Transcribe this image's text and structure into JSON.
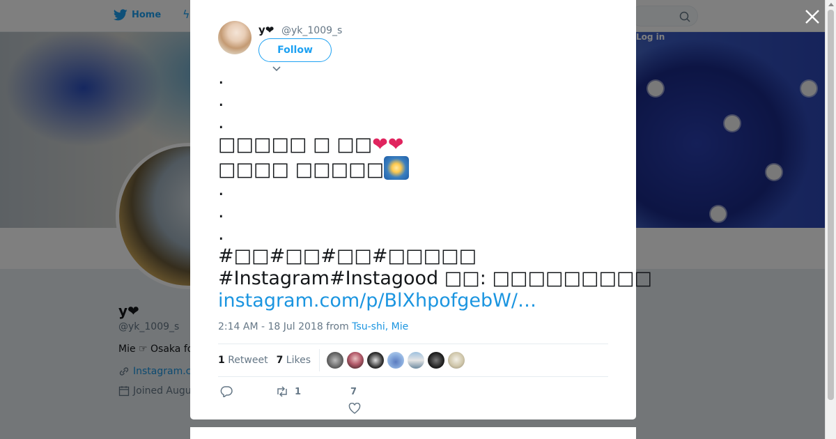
{
  "background": {
    "nav": {
      "home_label": "Home",
      "login_label": "Log in"
    },
    "profile": {
      "name": "y❤",
      "handle": "@yk_1009_s",
      "bio": "Mie ☞ Osaka fo",
      "link": "Instagram.c",
      "joined": "Joined Augu"
    }
  },
  "tweet": {
    "display_name": "y❤",
    "screen_name": "@yk_1009_s",
    "follow_label": "Follow",
    "text_lines": [
      ".",
      ".",
      ".",
      "□□□□□ □ □□",
      "□□□□ □□□□□",
      ".",
      ".",
      ".",
      "#□□#□□#□□#□□□□□",
      "#Instagram#Instagood □□: □□□□□□□□□"
    ],
    "link_text": "instagram.com/p/BlXhpofgebW/…",
    "timestamp": "2:14 AM - 18 Jul 2018 from ",
    "location": "Tsu-shi, Mie",
    "retweet_count": "1",
    "retweet_label": "Retweet",
    "likes_count": "7",
    "likes_label": "Likes",
    "action_retweet_count": "1",
    "action_like_count": "7"
  },
  "colors": {
    "accent": "#1da1f2",
    "link": "#1b95e0",
    "heart": "#e0245e",
    "text": "#14171a",
    "muted": "#657786"
  },
  "icons": [
    "twitter-bird-icon",
    "lightning-icon",
    "search-icon",
    "close-icon",
    "chevron-down-icon",
    "link-icon",
    "calendar-icon",
    "reply-icon",
    "retweet-icon",
    "like-icon"
  ]
}
